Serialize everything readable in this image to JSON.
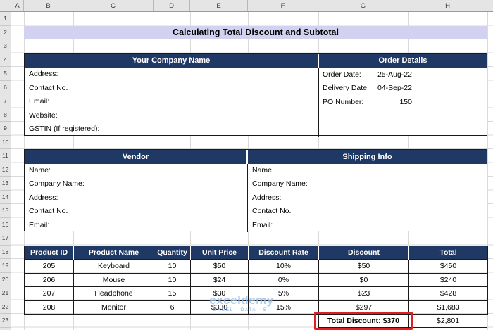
{
  "grid": {
    "columns": [
      "A",
      "B",
      "C",
      "D",
      "E",
      "F",
      "G",
      "H"
    ],
    "rows": [
      "1",
      "2",
      "3",
      "4",
      "5",
      "6",
      "7",
      "8",
      "9",
      "10",
      "11",
      "12",
      "13",
      "14",
      "15",
      "16",
      "17",
      "18",
      "19",
      "20",
      "21",
      "22",
      "23"
    ]
  },
  "title": "Calculating Total Discount and Subtotal",
  "company": {
    "header": "Your Company Name",
    "fields": [
      "Address:",
      "Contact No.",
      "Email:",
      "Website:",
      "GSTIN (If registered):"
    ]
  },
  "order_details": {
    "header": "Order Details",
    "fields": [
      {
        "label": "Order Date:",
        "value": "25-Aug-22"
      },
      {
        "label": "Delivery Date:",
        "value": "04-Sep-22"
      },
      {
        "label": "PO Number:",
        "value": "150"
      }
    ]
  },
  "vendor": {
    "header": "Vendor",
    "fields": [
      "Name:",
      "Company Name:",
      "Address:",
      "Contact No.",
      "Email:"
    ]
  },
  "shipping": {
    "header": "Shipping Info",
    "fields": [
      "Name:",
      "Company Name:",
      "Address:",
      "Contact No.",
      "Email:"
    ]
  },
  "po_table": {
    "headers": [
      "Product ID",
      "Product Name",
      "Quantity",
      "Unit Price",
      "Discount Rate",
      "Discount",
      "Total"
    ],
    "rows": [
      {
        "product_id": "205",
        "product_name": "Keyboard",
        "quantity": "10",
        "unit_price": "$50",
        "discount_rate": "10%",
        "discount": "$50",
        "total": "$450"
      },
      {
        "product_id": "206",
        "product_name": "Mouse",
        "quantity": "10",
        "unit_price": "$24",
        "discount_rate": "0%",
        "discount": "$0",
        "total": "$240"
      },
      {
        "product_id": "207",
        "product_name": "Headphone",
        "quantity": "15",
        "unit_price": "$30",
        "discount_rate": "5%",
        "discount": "$23",
        "total": "$428"
      },
      {
        "product_id": "208",
        "product_name": "Monitor",
        "quantity": "6",
        "unit_price": "$330",
        "discount_rate": "15%",
        "discount": "$297",
        "total": "$1,683"
      }
    ],
    "total_discount_label": "Total Discount: $370",
    "grand_total": "$2,801"
  },
  "watermark": {
    "brand": "exceldemy",
    "tagline": "EXCEL · DATA · BI"
  },
  "colors": {
    "header_navy": "#1F3864",
    "title_lavender": "#D2D2F0",
    "highlight_red": "#E02020",
    "watermark_blue": "#9CC0E8"
  }
}
